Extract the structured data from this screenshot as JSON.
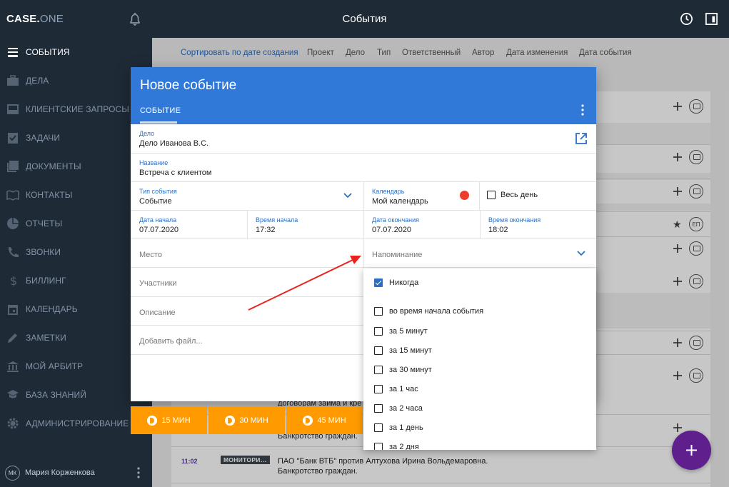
{
  "app": {
    "logo_main": "CASE.",
    "logo_accent": "ONE",
    "page_title": "События"
  },
  "sidebar": {
    "items": [
      {
        "label": "СОБЫТИЯ"
      },
      {
        "label": "ДЕЛА"
      },
      {
        "label": "КЛИЕНТСКИЕ ЗАПРОСЫ"
      },
      {
        "label": "ЗАДАЧИ"
      },
      {
        "label": "ДОКУМЕНТЫ"
      },
      {
        "label": "КОНТАКТЫ"
      },
      {
        "label": "ОТЧЕТЫ"
      },
      {
        "label": "ЗВОНКИ"
      },
      {
        "label": "БИЛЛИНГ"
      },
      {
        "label": "КАЛЕНДАРЬ"
      },
      {
        "label": "ЗАМЕТКИ"
      },
      {
        "label": "МОЙ АРБИТР"
      },
      {
        "label": "БАЗА ЗНАНИЙ"
      },
      {
        "label": "АДМИНИСТРИРОВАНИЕ"
      }
    ],
    "user": {
      "initials": "МК",
      "name": "Мария Корженкова"
    }
  },
  "sortbar": {
    "items": [
      "Сортировать по дате создания",
      "Проект",
      "Дело",
      "Тип",
      "Ответственный",
      "Автор",
      "Дата изменения",
      "Дата события"
    ]
  },
  "background": {
    "row_text_1": "договорам займа и кре",
    "row_text_2": "Банкротство граждан.",
    "row_time": "11:02",
    "row_badge": "МОНИТОРИ…",
    "row_text_3": "ПАО \"Банк ВТБ\" против Алтухова Ирина Вольдемаровна.",
    "row_text_4": "Банкротство граждан.",
    "ep_badge": "ЕП"
  },
  "dialog": {
    "title": "Новое событие",
    "tab": "СОБЫТИЕ",
    "case": {
      "label": "Дело",
      "value": "Дело Иванова В.С."
    },
    "name": {
      "label": "Название",
      "value": "Встреча с клиентом"
    },
    "event_type": {
      "label": "Тип события",
      "value": "Событие"
    },
    "calendar": {
      "label": "Календарь",
      "value": "Мой календарь",
      "dot_color": "#f03c2a"
    },
    "all_day": {
      "label": "Весь день",
      "checked": false
    },
    "start_date": {
      "label": "Дата начала",
      "value": "07.07.2020"
    },
    "start_time": {
      "label": "Время начала",
      "value": "17:32"
    },
    "end_date": {
      "label": "Дата окончания",
      "value": "07.07.2020"
    },
    "end_time": {
      "label": "Время окончания",
      "value": "18:02"
    },
    "place": {
      "placeholder": "Место"
    },
    "reminder": {
      "placeholder": "Напоминание"
    },
    "participants": {
      "placeholder": "Участники"
    },
    "description": {
      "placeholder": "Описание"
    },
    "add_file": {
      "placeholder": "Добавить файл..."
    }
  },
  "quick_buttons": [
    "15 МИН",
    "30 МИН",
    "45 МИН"
  ],
  "reminder_options": [
    {
      "label": "Никогда",
      "checked": true
    },
    {
      "label": "во время начала события",
      "checked": false
    },
    {
      "label": "за 5 минут",
      "checked": false
    },
    {
      "label": "за 15 минут",
      "checked": false
    },
    {
      "label": "за 30 минут",
      "checked": false
    },
    {
      "label": "за 1 час",
      "checked": false
    },
    {
      "label": "за 2 часа",
      "checked": false
    },
    {
      "label": "за 1 день",
      "checked": false
    },
    {
      "label": "за 2 дня",
      "checked": false
    }
  ],
  "colors": {
    "accent": "#3079d8",
    "sidebar": "#1f2a37",
    "orange": "#ff9b00",
    "fab": "#5f1f8c",
    "annotation_arrow": "#e8231d"
  }
}
